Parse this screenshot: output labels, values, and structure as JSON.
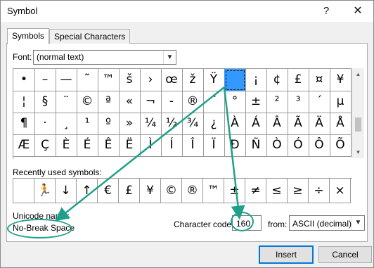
{
  "window": {
    "title": "Symbol",
    "help_glyph": "?",
    "close_glyph": "✕"
  },
  "tabs": [
    {
      "label": "Symbols",
      "active": true
    },
    {
      "label": "Special Characters",
      "active": false
    }
  ],
  "font": {
    "label": "Font:",
    "value": "(normal text)"
  },
  "symbol_grid": [
    [
      "•",
      "–",
      "—",
      "˜",
      "™",
      "š",
      "›",
      "œ",
      "ž",
      "Ÿ",
      " ",
      "¡",
      "¢",
      "£",
      "¤",
      "¥"
    ],
    [
      "¦",
      "§",
      "¨",
      "©",
      "ª",
      "«",
      "¬",
      "-",
      "®",
      "¯",
      "°",
      "±",
      "²",
      "³",
      "´",
      "µ"
    ],
    [
      "¶",
      "·",
      "¸",
      "¹",
      "º",
      "»",
      "¼",
      "½",
      "¾",
      "¿",
      "À",
      "Á",
      "Â",
      "Ã",
      "Ä",
      "Å"
    ],
    [
      "Æ",
      "Ç",
      "È",
      "É",
      "Ê",
      "Ë",
      "Ì",
      "Í",
      "Î",
      "Ï",
      "Ð",
      "Ñ",
      "Ò",
      "Ó",
      "Ô",
      "Õ"
    ]
  ],
  "selected_symbol": "No-Break Space",
  "recent": {
    "label": "Recently used symbols:",
    "symbols": [
      "",
      "🏃",
      "↓",
      "↑",
      "€",
      "£",
      "¥",
      "©",
      "®",
      "™",
      "±",
      "≠",
      "≤",
      "≥",
      "÷",
      "×"
    ]
  },
  "unicode": {
    "label": "Unicode name:",
    "name": "No-Break Space"
  },
  "character_code": {
    "label": "Character code:",
    "value": "160"
  },
  "from": {
    "label": "from:",
    "value": "ASCII (decimal)"
  },
  "buttons": {
    "insert": "Insert",
    "cancel": "Cancel"
  },
  "colors": {
    "selection": "#3399ff",
    "annotation": "#1fa08a",
    "focus": "#0078d7"
  }
}
